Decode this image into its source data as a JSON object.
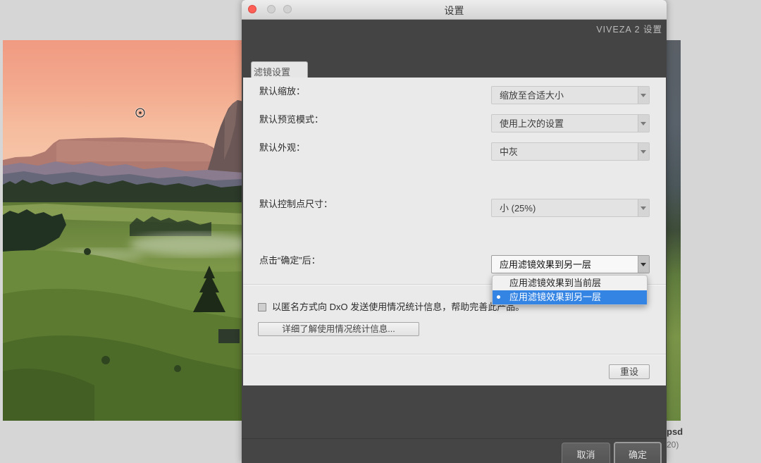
{
  "window": {
    "title": "设置",
    "header_title": "VIVEZA 2 设置"
  },
  "tabs": [
    {
      "label": "滤镜设置",
      "active": true
    }
  ],
  "settings": [
    {
      "label": "默认缩放：",
      "value": "缩放至合适大小"
    },
    {
      "label": "默认预览模式：",
      "value": "使用上次的设置"
    },
    {
      "label": "默认外观：",
      "value": "中灰"
    },
    {
      "label": "默认控制点尺寸：",
      "value": "小 (25%)"
    },
    {
      "label": "点击“确定”后：",
      "value": "应用滤镜效果到另一层",
      "open": true
    }
  ],
  "after_ok_menu": {
    "options": [
      {
        "label": "应用滤镜效果到当前层",
        "selected": false
      },
      {
        "label": "应用滤镜效果到另一层",
        "selected": true
      }
    ]
  },
  "usage_stats": {
    "checkbox_label": "以匿名方式向 DxO 发送使用情况统计信息，帮助完善此产品。",
    "checked": false,
    "learn_more_button": "详细了解使用情况统计信息..."
  },
  "reset_button": "重设",
  "footer": {
    "cancel_button": "取消",
    "ok_button": "确定"
  },
  "background": {
    "file_name_fragment": "psd",
    "file_info_fragment": "20)"
  },
  "colors": {
    "accent": "#3484e4",
    "close_button": "#fd5f57",
    "panel": "#eaeaea",
    "chrome_dark": "#454545"
  }
}
